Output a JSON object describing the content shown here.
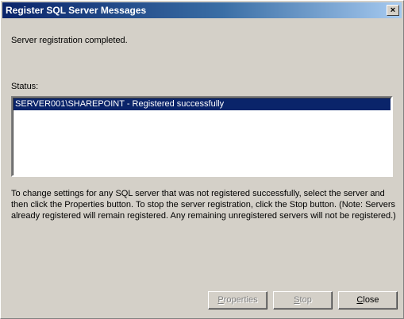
{
  "window": {
    "title": "Register SQL Server Messages",
    "close_glyph": "×"
  },
  "message": "Server registration completed.",
  "status": {
    "label": "Status:",
    "items": [
      "SERVER001\\SHAREPOINT - Registered successfully"
    ]
  },
  "info_text": "To change settings for any SQL server that was not registered successfully, select the server and then click the Properties button.  To stop the server registration, click the Stop button. (Note: Servers already registered will remain registered.  Any remaining unregistered servers will not be registered.)",
  "buttons": {
    "properties": {
      "first": "P",
      "rest": "roperties",
      "enabled": false
    },
    "stop": {
      "first": "S",
      "rest": "top",
      "enabled": false
    },
    "close": {
      "first": "C",
      "rest": "lose",
      "enabled": true
    }
  },
  "colors": {
    "title_start": "#0a246a",
    "title_end": "#a6caf0",
    "selection": "#0a246a",
    "face": "#d4d0c8"
  }
}
